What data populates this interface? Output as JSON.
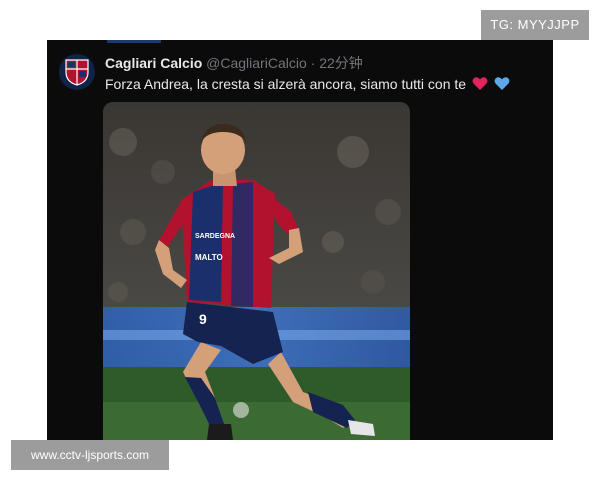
{
  "tweet": {
    "display_name": "Cagliari Calcio",
    "handle": "@CagliariCalcio",
    "separator": "·",
    "time": "22分钟",
    "text": "Forza Andrea, la cresta si alzerà ancora, siamo tutti con te",
    "emojis": [
      "red-heart",
      "blue-heart"
    ],
    "media": {
      "jersey_number": "9",
      "sponsor_chest": "SARDEGNA",
      "sponsor_lower": "MALTO",
      "colors": {
        "jersey_red": "#b3122e",
        "jersey_blue": "#1a2f6b",
        "shorts": "#14234f"
      }
    }
  },
  "watermarks": {
    "top": "TG: MYYJJPP",
    "bottom": "www.cctv-ljsports.com"
  },
  "colors": {
    "card_bg": "#0b0b0b",
    "text": "#e7e9ea",
    "muted": "#71767b",
    "watermark_bg": "#9c9c9c"
  }
}
